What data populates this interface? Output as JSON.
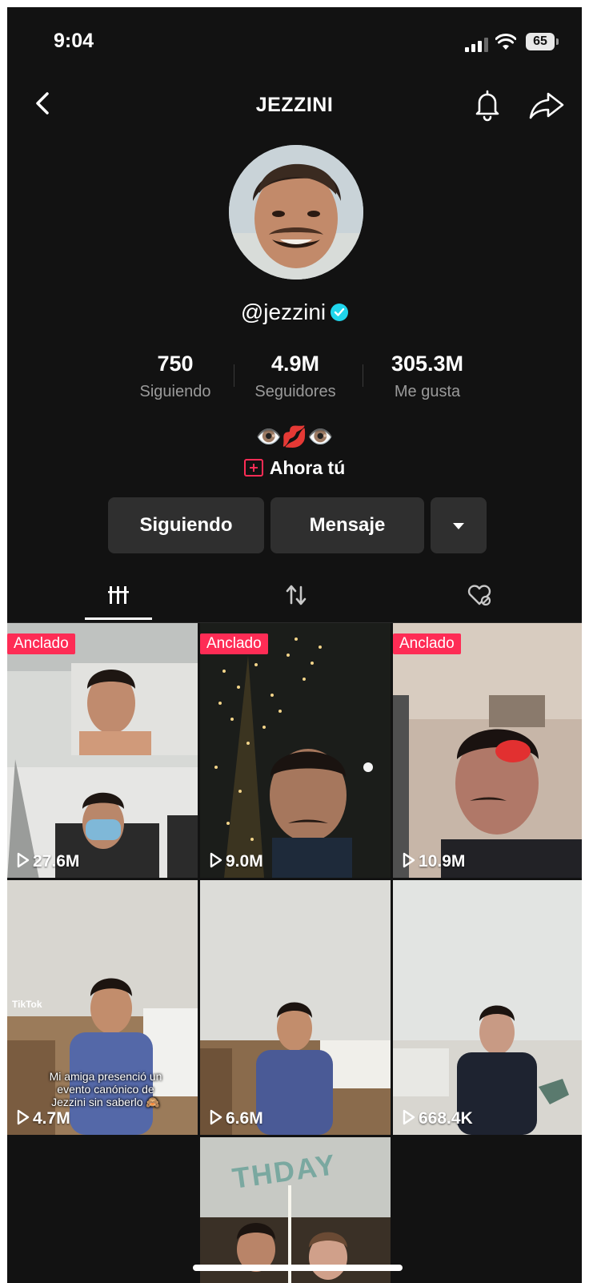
{
  "status_bar": {
    "time": "9:04",
    "battery": "65"
  },
  "header": {
    "title": "JEZZINI"
  },
  "profile": {
    "username": "@jezzini",
    "bio_emoji": "👁️💋👁️",
    "bio_link": "Ahora tú"
  },
  "stats": [
    {
      "value": "750",
      "label": "Siguiendo"
    },
    {
      "value": "4.9M",
      "label": "Seguidores"
    },
    {
      "value": "305.3M",
      "label": "Me gusta"
    }
  ],
  "actions": {
    "following": "Siguiendo",
    "message": "Mensaje"
  },
  "videos": [
    {
      "pinned": "Anclado",
      "views": "27.6M"
    },
    {
      "pinned": "Anclado",
      "views": "9.0M"
    },
    {
      "pinned": "Anclado",
      "views": "10.9M"
    },
    {
      "views": "4.7M",
      "overlay": "Mi amiga presenció un evento canónico de Jezzini sin saberlo 🙈",
      "watermark": "TikTok"
    },
    {
      "views": "6.6M"
    },
    {
      "views": "668.4K"
    },
    {
      "overlay": "THDAY"
    }
  ],
  "colors": {
    "accent": "#fe2c55",
    "verified": "#20d5ec",
    "background": "#121212"
  }
}
